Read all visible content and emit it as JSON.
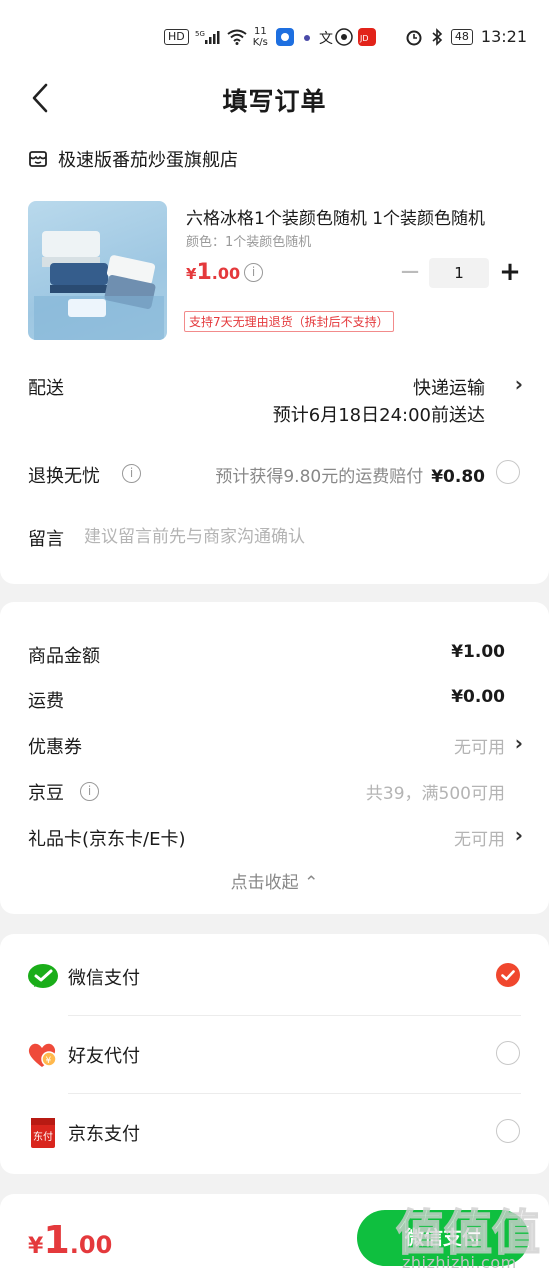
{
  "status_bar": {
    "network_speed_value": "11",
    "network_speed_unit": "K/s",
    "battery": "48",
    "time": "13:21",
    "icons": [
      "hd-icon",
      "5g-signal-icon",
      "wifi-icon",
      "app-notification-icons",
      "alarm-icon",
      "bluetooth-icon",
      "battery-icon"
    ]
  },
  "header": {
    "title": "填写订单",
    "back_icon": "chevron-left-icon"
  },
  "shop": {
    "name": "极速版番茄炒蛋旗舰店",
    "icon": "shop-icon"
  },
  "product": {
    "title": "六格冰格1个装颜色随机 1个装颜色随机",
    "spec": "颜色：1个装颜色随机",
    "price_currency": "¥",
    "price_int": "1",
    "price_dec": ".00",
    "quantity": "1",
    "minus": "−",
    "plus": "+",
    "return_tag": "支持7天无理由退货（拆封后不支持）"
  },
  "delivery": {
    "label": "配送",
    "method": "快递运输",
    "eta": "预计6月18日24:00前送达"
  },
  "tuihuan": {
    "label": "退换无忧",
    "desc": "预计获得9.80元的运费赔付",
    "price": "¥0.80"
  },
  "message": {
    "label": "留言",
    "placeholder": "建议留言前先与商家沟通确认"
  },
  "summary": {
    "rows": [
      {
        "label": "商品金额",
        "value": "¥1.00"
      },
      {
        "label": "运费",
        "value": "¥0.00"
      },
      {
        "label": "优惠券",
        "value": "无可用"
      },
      {
        "label": "京豆",
        "value": "共39，满500可用"
      },
      {
        "label": "礼品卡(京东卡/E卡)",
        "value": "无可用"
      }
    ],
    "collapse": "点击收起 ⌃"
  },
  "payment": {
    "methods": [
      {
        "label": "微信支付",
        "icon": "wechat-pay-icon",
        "selected": true
      },
      {
        "label": "好友代付",
        "icon": "friend-pay-heart-icon",
        "selected": false
      },
      {
        "label": "京东支付",
        "icon": "jd-pay-icon",
        "selected": false
      }
    ],
    "jd_icon_text": "东付"
  },
  "footer": {
    "total_currency": "¥",
    "total_int": "1",
    "total_dec": ".00",
    "submit": "微信支付"
  },
  "watermark": {
    "logo_text": "值值值",
    "site": "zhizhizhi.com"
  },
  "colors": {
    "price_red": "#e4393c",
    "wechat_green": "#0fbf3f",
    "check_orange": "#f0472e"
  }
}
